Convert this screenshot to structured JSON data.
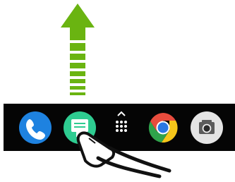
{
  "screen": {
    "background": "#ffffff",
    "gesture": "swipe-up-from-messages",
    "dock_color": "#050505"
  },
  "dock": {
    "apps": [
      {
        "icon": "phone-icon",
        "color": "#1e82e0"
      },
      {
        "icon": "messages-icon",
        "color": "#2ecc91"
      },
      {
        "icon": "app-drawer-icon",
        "color": "#ffffff"
      },
      {
        "icon": "chrome-icon",
        "color": "#e84c3d"
      },
      {
        "icon": "camera-icon",
        "color": "#e4e4e4"
      }
    ]
  },
  "gesture_arrow": {
    "icon": "up-arrow-icon",
    "color": "#6ab411",
    "direction": "up"
  },
  "touch": {
    "icon": "finger-hand-icon",
    "line_color": "#111111",
    "fill_color": "#ffffff"
  }
}
